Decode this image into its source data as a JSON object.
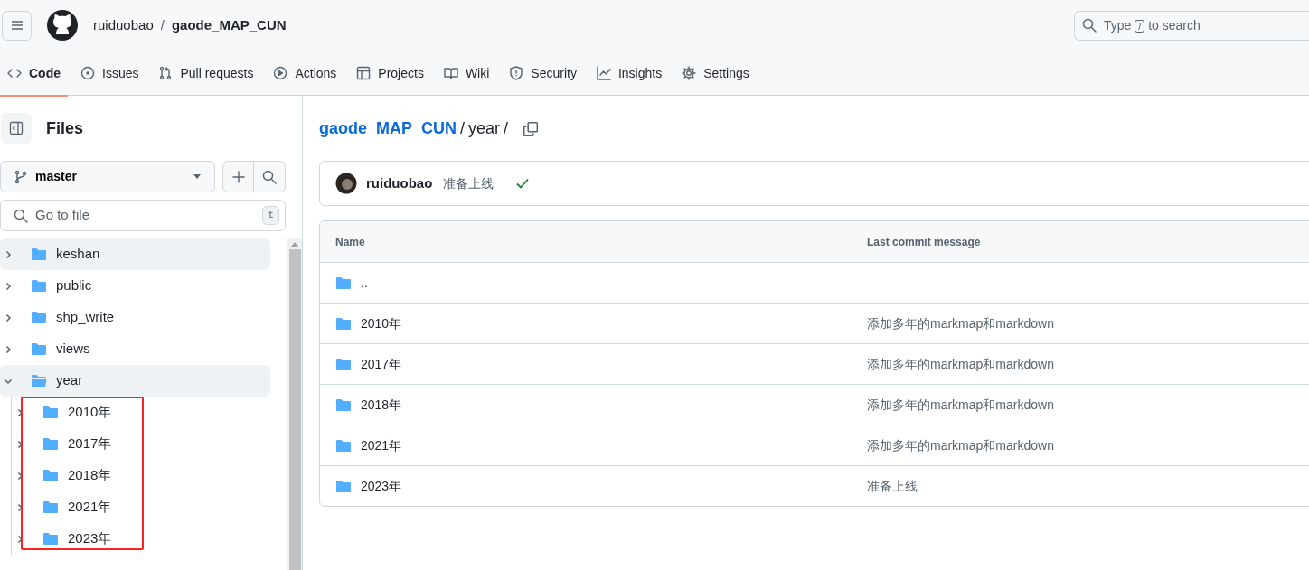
{
  "header": {
    "owner": "ruiduobao",
    "separator": "/",
    "repo": "gaode_MAP_CUN",
    "search": {
      "placeholder_before": "Type",
      "key": "/",
      "placeholder_after": "to search"
    }
  },
  "tabs": [
    {
      "label": "Code",
      "kind": "code",
      "selected": true
    },
    {
      "label": "Issues",
      "kind": "issue",
      "selected": false
    },
    {
      "label": "Pull requests",
      "kind": "pr",
      "selected": false
    },
    {
      "label": "Actions",
      "kind": "play",
      "selected": false
    },
    {
      "label": "Projects",
      "kind": "table",
      "selected": false
    },
    {
      "label": "Wiki",
      "kind": "book",
      "selected": false
    },
    {
      "label": "Security",
      "kind": "shield",
      "selected": false
    },
    {
      "label": "Insights",
      "kind": "graph",
      "selected": false
    },
    {
      "label": "Settings",
      "kind": "gear",
      "selected": false
    }
  ],
  "sidebar": {
    "title": "Files",
    "branch": "master",
    "go_to_file": {
      "placeholder": "Go to file",
      "key": "t"
    },
    "tree": [
      {
        "name": "keshan",
        "expanded": false,
        "highlighted": true
      },
      {
        "name": "public",
        "expanded": false,
        "highlighted": false
      },
      {
        "name": "shp_write",
        "expanded": false,
        "highlighted": false
      },
      {
        "name": "views",
        "expanded": false,
        "highlighted": false
      },
      {
        "name": "year",
        "expanded": true,
        "highlighted": true,
        "children_marked": true,
        "children": [
          {
            "name": "2010年",
            "expanded": false,
            "highlighted": false
          },
          {
            "name": "2017年",
            "expanded": false,
            "highlighted": false
          },
          {
            "name": "2018年",
            "expanded": false,
            "highlighted": false
          },
          {
            "name": "2021年",
            "expanded": false,
            "highlighted": false
          },
          {
            "name": "2023年",
            "expanded": false,
            "highlighted": false
          }
        ]
      }
    ]
  },
  "breadcrumb": {
    "repo": "gaode_MAP_CUN",
    "path": "year",
    "separator": "/"
  },
  "commit": {
    "author": "ruiduobao",
    "message": "准备上线",
    "checks_passed": true
  },
  "table": {
    "columns": [
      "Name",
      "Last commit message"
    ],
    "rows": [
      {
        "name": ".."
      },
      {
        "name": "2010年",
        "message": "添加多年的markmap和markdown"
      },
      {
        "name": "2017年",
        "message": "添加多年的markmap和markdown"
      },
      {
        "name": "2018年",
        "message": "添加多年的markmap和markdown"
      },
      {
        "name": "2021年",
        "message": "添加多年的markmap和markdown"
      },
      {
        "name": "2023年",
        "message": "准备上线"
      }
    ]
  }
}
